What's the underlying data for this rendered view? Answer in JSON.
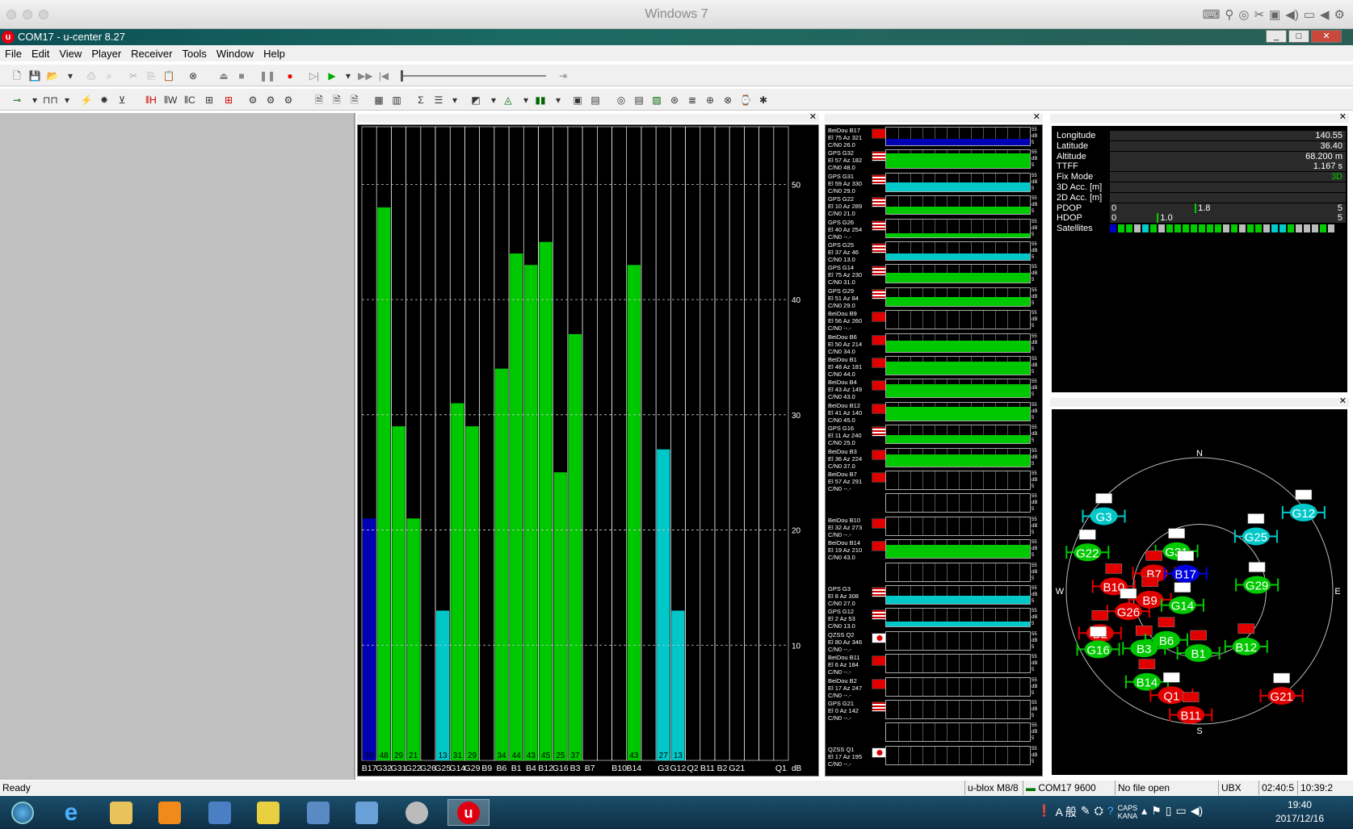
{
  "mac": {
    "title": "Windows 7"
  },
  "window": {
    "title": "COM17 - u-center 8.27",
    "app_icon": "u"
  },
  "menu": [
    "File",
    "Edit",
    "View",
    "Player",
    "Receiver",
    "Tools",
    "Window",
    "Help"
  ],
  "chart_data": {
    "type": "bar",
    "title": "",
    "ylabel": "dB",
    "ylim": [
      0,
      55
    ],
    "yticks": [
      10,
      20,
      30,
      40,
      50
    ],
    "categories": [
      "B17",
      "G32",
      "G31",
      "G22",
      "G26",
      "G25",
      "G14",
      "G29",
      "B9",
      "B6",
      "B1",
      "B4",
      "B12",
      "G16",
      "B3",
      "B7",
      "",
      "B10",
      "B14",
      "",
      "G3",
      "G12",
      "Q2",
      "B11",
      "B2",
      "G21",
      "",
      "",
      "Q1"
    ],
    "values": [
      21,
      48,
      29,
      21,
      0,
      13,
      31,
      29,
      0,
      34,
      44,
      43,
      45,
      25,
      37,
      0,
      0,
      0,
      43,
      0,
      27,
      13,
      0,
      0,
      0,
      0,
      0,
      0,
      0
    ],
    "value_labels": [
      "20",
      "48",
      "29",
      "21",
      "",
      "13",
      "31",
      "29",
      "",
      "34",
      "44",
      "43",
      "45",
      "25",
      "37",
      "",
      "",
      "",
      "43",
      "",
      "27",
      "13",
      "",
      "",
      "",
      "",
      "",
      "",
      ""
    ],
    "colors": [
      "#0000b4",
      "#00c800",
      "#00c800",
      "#00c800",
      "#00c800",
      "#00c8c8",
      "#00c800",
      "#00c800",
      "#00c800",
      "#00c800",
      "#00c800",
      "#00c800",
      "#00c800",
      "#00c800",
      "#00c800",
      "#00c800",
      "#00c800",
      "#00c800",
      "#00c800",
      "#00c800",
      "#00c8c8",
      "#00c8c8",
      "#00c800",
      "#00c800",
      "#00c800",
      "#00c800",
      "#00c800",
      "#00c800",
      "#00c800"
    ]
  },
  "signal_list": [
    {
      "name": "BeiDou B17",
      "pos": "El 75 Az 321",
      "cn": "C/N0 26.0",
      "flag": "CN",
      "level": 0.35,
      "color": "#0000b4"
    },
    {
      "name": "GPS G32",
      "pos": "El 57 Az 182",
      "cn": "C/N0 48.0",
      "flag": "US",
      "level": 0.85,
      "color": "#00c800"
    },
    {
      "name": "GPS G31",
      "pos": "El 59 Az 330",
      "cn": "C/N0 29.0",
      "flag": "US",
      "level": 0.5,
      "color": "#00c8c8"
    },
    {
      "name": "GPS G22",
      "pos": "El 10 Az 289",
      "cn": "C/N0 21.0",
      "flag": "US",
      "level": 0.4,
      "color": "#00c800"
    },
    {
      "name": "GPS G26",
      "pos": "El 40 Az 254",
      "cn": "C/N0 --.-",
      "flag": "US",
      "level": 0.2,
      "color": "#00c800"
    },
    {
      "name": "GPS G25",
      "pos": "El 37 Az 46",
      "cn": "C/N0 13.0",
      "flag": "US",
      "level": 0.35,
      "color": "#00c8c8"
    },
    {
      "name": "GPS G14",
      "pos": "El 75 Az 230",
      "cn": "C/N0 31.0",
      "flag": "US",
      "level": 0.55,
      "color": "#00c800"
    },
    {
      "name": "GPS G29",
      "pos": "El 51 Az 84",
      "cn": "C/N0 29.0",
      "flag": "US",
      "level": 0.5,
      "color": "#00c800"
    },
    {
      "name": "BeiDou B9",
      "pos": "El 56 Az 260",
      "cn": "C/N0 --.-",
      "flag": "CN",
      "level": 0,
      "color": "#00c800"
    },
    {
      "name": "BeiDou B6",
      "pos": "El 50 Az 214",
      "cn": "C/N0 34.0",
      "flag": "CN",
      "level": 0.6,
      "color": "#00c800"
    },
    {
      "name": "BeiDou B1",
      "pos": "El 48 Az 181",
      "cn": "C/N0 44.0",
      "flag": "CN",
      "level": 0.75,
      "color": "#00c800"
    },
    {
      "name": "BeiDou B4",
      "pos": "El 43 Az 149",
      "cn": "C/N0 43.0",
      "flag": "CN",
      "level": 0.75,
      "color": "#00c800"
    },
    {
      "name": "BeiDou B12",
      "pos": "El 41 Az 140",
      "cn": "C/N0 45.0",
      "flag": "CN",
      "level": 0.78,
      "color": "#00c800"
    },
    {
      "name": "GPS G16",
      "pos": "El 11 Az 240",
      "cn": "C/N0 25.0",
      "flag": "US",
      "level": 0.45,
      "color": "#00c800"
    },
    {
      "name": "BeiDou B3",
      "pos": "El 36 Az 224",
      "cn": "C/N0 37.0",
      "flag": "CN",
      "level": 0.65,
      "color": "#00c800"
    },
    {
      "name": "BeiDou B7",
      "pos": "El 57 Az 291",
      "cn": "C/N0 --.-",
      "flag": "CN",
      "level": 0,
      "color": "#00c800"
    },
    {
      "name": "",
      "pos": "",
      "cn": "",
      "flag": "",
      "level": 0,
      "color": "#00c800"
    },
    {
      "name": "BeiDou B10",
      "pos": "El 32 Az 273",
      "cn": "C/N0 --.-",
      "flag": "CN",
      "level": 0,
      "color": "#00c800"
    },
    {
      "name": "BeiDou B14",
      "pos": "El 19 Az 210",
      "cn": "C/N0 43.0",
      "flag": "CN",
      "level": 0.75,
      "color": "#00c800"
    },
    {
      "name": "",
      "pos": "",
      "cn": "",
      "flag": "",
      "level": 0,
      "color": "#00c800"
    },
    {
      "name": "GPS G3",
      "pos": "El 8 Az 308",
      "cn": "C/N0 27.0",
      "flag": "US",
      "level": 0.45,
      "color": "#00c8c8"
    },
    {
      "name": "GPS G12",
      "pos": "El 2 Az 53",
      "cn": "C/N0 13.0",
      "flag": "US",
      "level": 0.3,
      "color": "#00c8c8"
    },
    {
      "name": "QZSS Q2",
      "pos": "El 80 Az 346",
      "cn": "C/N0 --.-",
      "flag": "JP",
      "level": 0,
      "color": "#00c800"
    },
    {
      "name": "BeiDou B11",
      "pos": "El 6 Az 184",
      "cn": "C/N0 --.-",
      "flag": "CN",
      "level": 0,
      "color": "#00c800"
    },
    {
      "name": "BeiDou B2",
      "pos": "El 17 Az 247",
      "cn": "C/N0 --.-",
      "flag": "CN",
      "level": 0,
      "color": "#00c800"
    },
    {
      "name": "GPS G21",
      "pos": "El 0 Az 142",
      "cn": "C/N0 --.-",
      "flag": "US",
      "level": 0,
      "color": "#00c800"
    },
    {
      "name": "",
      "pos": "",
      "cn": "",
      "flag": "",
      "level": 0,
      "color": "#00c800"
    },
    {
      "name": "QZSS Q1",
      "pos": "El 17 Az 195",
      "cn": "C/N0 --.-",
      "flag": "JP",
      "level": 0,
      "color": "#00c800"
    }
  ],
  "signal_scale": {
    "top": "55",
    "unit": "dB",
    "bottom": "5"
  },
  "nav": [
    {
      "key": "Longitude",
      "value": "140.55"
    },
    {
      "key": "Latitude",
      "value": "36.40"
    },
    {
      "key": "Altitude",
      "value": "68.200 m"
    },
    {
      "key": "TTFF",
      "value": "1.167 s"
    },
    {
      "key": "Fix Mode",
      "value": "3D"
    },
    {
      "key": "3D Acc. [m]",
      "value": ""
    },
    {
      "key": "2D Acc. [m]",
      "value": ""
    },
    {
      "key": "PDOP",
      "value": "1.8",
      "min": "0",
      "max": "5"
    },
    {
      "key": "HDOP",
      "value": "1.0",
      "min": "0",
      "max": "5"
    },
    {
      "key": "Satellites",
      "value": ""
    }
  ],
  "sky": {
    "compass": [
      "N",
      "E",
      "S",
      "W"
    ],
    "sats": [
      {
        "id": "G3",
        "az": 308,
        "el": 8,
        "color": "#00c8c8",
        "flag": "US"
      },
      {
        "id": "G12",
        "az": 53,
        "el": 2,
        "color": "#00c8c8",
        "flag": "US"
      },
      {
        "id": "G22",
        "az": 289,
        "el": 10,
        "color": "#00c800",
        "flag": "US"
      },
      {
        "id": "G25",
        "az": 46,
        "el": 37,
        "color": "#00c8c8",
        "flag": "US"
      },
      {
        "id": "G31",
        "az": 330,
        "el": 59,
        "color": "#00c800",
        "flag": "US"
      },
      {
        "id": "B7",
        "az": 291,
        "el": 57,
        "color": "#e00000",
        "flag": "CN"
      },
      {
        "id": "B17",
        "az": 321,
        "el": 75,
        "color": "#0000e0",
        "flag": "JP"
      },
      {
        "id": "G29",
        "az": 84,
        "el": 51,
        "color": "#00c800",
        "flag": "US"
      },
      {
        "id": "B10",
        "az": 273,
        "el": 32,
        "color": "#e00000",
        "flag": "CN"
      },
      {
        "id": "B9",
        "az": 260,
        "el": 56,
        "color": "#e00000",
        "flag": "CN"
      },
      {
        "id": "G14",
        "az": 230,
        "el": 75,
        "color": "#00c800",
        "flag": "US"
      },
      {
        "id": "G26",
        "az": 254,
        "el": 40,
        "color": "#e00000",
        "flag": "US"
      },
      {
        "id": "B2",
        "az": 247,
        "el": 17,
        "color": "#e00000",
        "flag": "CN"
      },
      {
        "id": "G16",
        "az": 240,
        "el": 11,
        "color": "#00c800",
        "flag": "US"
      },
      {
        "id": "B3",
        "az": 224,
        "el": 36,
        "color": "#00c800",
        "flag": "CN"
      },
      {
        "id": "B6",
        "az": 214,
        "el": 50,
        "color": "#00c800",
        "flag": "CN"
      },
      {
        "id": "B1",
        "az": 181,
        "el": 48,
        "color": "#00c800",
        "flag": "CN"
      },
      {
        "id": "B12",
        "az": 140,
        "el": 41,
        "color": "#00c800",
        "flag": "CN"
      },
      {
        "id": "B14",
        "az": 210,
        "el": 19,
        "color": "#00c800",
        "flag": "CN"
      },
      {
        "id": "Q1",
        "az": 195,
        "el": 17,
        "color": "#e00000",
        "flag": "JP"
      },
      {
        "id": "G21",
        "az": 142,
        "el": 0,
        "color": "#e00000",
        "flag": "US"
      },
      {
        "id": "B11",
        "az": 184,
        "el": 6,
        "color": "#e00000",
        "flag": "CN"
      }
    ]
  },
  "status": {
    "ready": "Ready",
    "receiver": "u-blox M8/8",
    "port": "COM17 9600",
    "file": "No file open",
    "protocol": "UBX",
    "time1": "02:40:5",
    "time2": "10:39:2"
  },
  "taskbar": {
    "time": "19:40",
    "date": "2017/12/16",
    "ime": "A 般"
  }
}
